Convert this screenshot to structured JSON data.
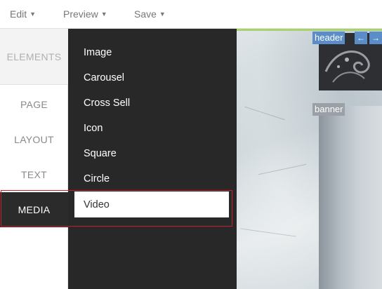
{
  "toolbar": {
    "edit_label": "Edit",
    "preview_label": "Preview",
    "save_label": "Save"
  },
  "sidebar": {
    "items": [
      {
        "label": "ELEMENTS"
      },
      {
        "label": "PAGE"
      },
      {
        "label": "LAYOUT"
      },
      {
        "label": "TEXT"
      },
      {
        "label": "MEDIA"
      }
    ]
  },
  "flyout": {
    "items": [
      {
        "label": "Image"
      },
      {
        "label": "Carousel"
      },
      {
        "label": "Cross Sell"
      },
      {
        "label": "Icon"
      },
      {
        "label": "Square"
      },
      {
        "label": "Circle"
      },
      {
        "label": "Video"
      }
    ]
  },
  "canvas": {
    "header_tag": "header",
    "banner_tag": "banner",
    "prev_icon": "arrow-left-icon",
    "next_icon": "arrow-right-icon"
  },
  "colors": {
    "highlight": "#c8202a",
    "flyout_bg": "#282828",
    "tag_blue": "#5b8ec9",
    "accent_green": "#a8d26a"
  }
}
